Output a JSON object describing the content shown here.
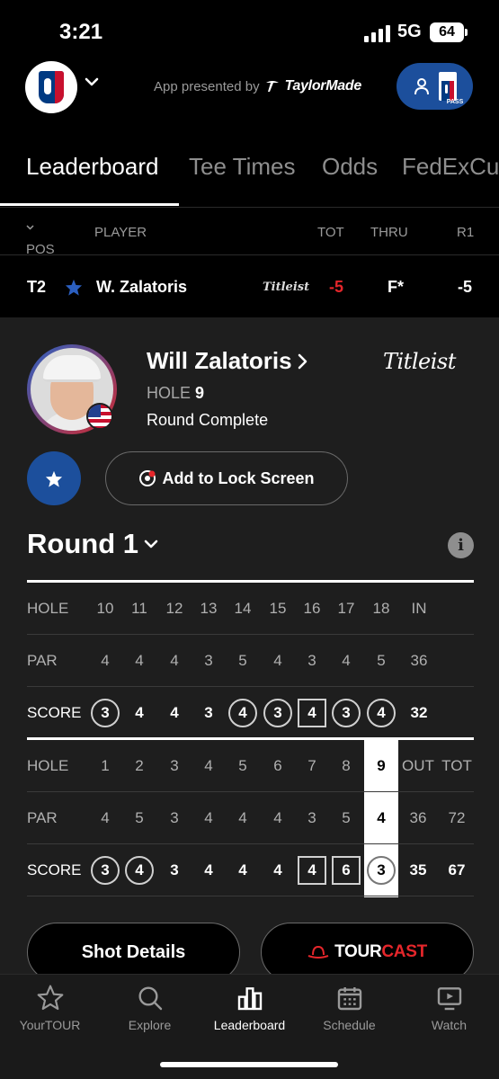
{
  "status": {
    "time": "3:21",
    "network": "5G",
    "battery": "64"
  },
  "header": {
    "presented_prefix": "App presented by",
    "presented_brand": "TaylorMade",
    "pass_label": "PASS"
  },
  "tabs": [
    {
      "label": "Leaderboard",
      "active": true
    },
    {
      "label": "Tee Times",
      "active": false
    },
    {
      "label": "Odds",
      "active": false
    },
    {
      "label": "FedExCu",
      "active": false
    }
  ],
  "leaderboard": {
    "columns": {
      "pos": "POS",
      "player": "PLAYER",
      "tot": "TOT",
      "thru": "THRU",
      "r1": "R1"
    },
    "row": {
      "pos": "T2",
      "player": "W. Zalatoris",
      "sponsor": "Titleist",
      "tot": "-5",
      "thru": "F*",
      "r1": "-5"
    }
  },
  "player": {
    "name": "Will Zalatoris",
    "hole_label": "HOLE",
    "hole_value": "9",
    "status": "Round Complete",
    "sponsor": "Titleist",
    "lock_screen_label": "Add to Lock Screen"
  },
  "round": {
    "title": "Round 1",
    "info": "i"
  },
  "scorecard": {
    "back": {
      "hole_label": "HOLE",
      "par_label": "PAR",
      "score_label": "SCORE",
      "holes": [
        "10",
        "11",
        "12",
        "13",
        "14",
        "15",
        "16",
        "17",
        "18",
        "IN"
      ],
      "pars": [
        "4",
        "4",
        "4",
        "3",
        "5",
        "4",
        "3",
        "4",
        "5",
        "36"
      ],
      "scores": [
        "3",
        "4",
        "4",
        "3",
        "4",
        "3",
        "4",
        "3",
        "4",
        "32"
      ],
      "marks": [
        "circle",
        "",
        "",
        "",
        "circle",
        "circle",
        "square",
        "circle",
        "circle",
        ""
      ]
    },
    "front": {
      "hole_label": "HOLE",
      "par_label": "PAR",
      "score_label": "SCORE",
      "holes": [
        "1",
        "2",
        "3",
        "4",
        "5",
        "6",
        "7",
        "8",
        "9",
        "OUT",
        "TOT"
      ],
      "pars": [
        "4",
        "5",
        "3",
        "4",
        "4",
        "4",
        "3",
        "5",
        "4",
        "36",
        "72"
      ],
      "scores": [
        "3",
        "4",
        "3",
        "4",
        "4",
        "4",
        "4",
        "6",
        "3",
        "35",
        "67"
      ],
      "marks": [
        "circle",
        "circle",
        "",
        "",
        "",
        "",
        "square",
        "square",
        "circle",
        "",
        ""
      ]
    }
  },
  "buttons": {
    "shot_details": "Shot Details",
    "tourcast_a": "TOUR",
    "tourcast_b": "CAST"
  },
  "tabbar": [
    {
      "label": "YourTOUR",
      "icon": "star-icon",
      "active": false
    },
    {
      "label": "Explore",
      "icon": "search-icon",
      "active": false
    },
    {
      "label": "Leaderboard",
      "icon": "leaderboard-icon",
      "active": true
    },
    {
      "label": "Schedule",
      "icon": "calendar-icon",
      "active": false
    },
    {
      "label": "Watch",
      "icon": "play-icon",
      "active": false
    }
  ]
}
